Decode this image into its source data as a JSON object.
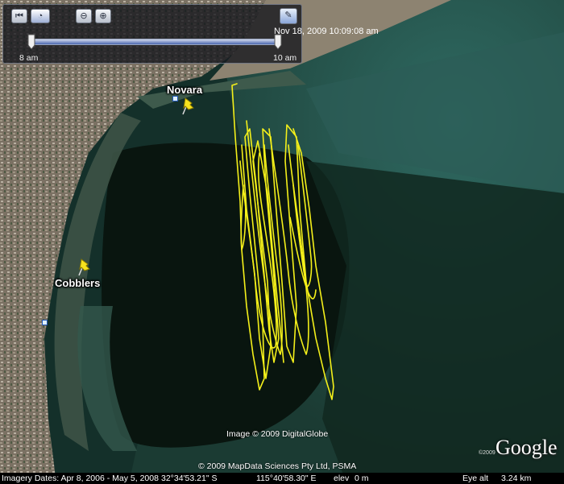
{
  "slider": {
    "date": "Nov 18, 2009  10:09:08 am",
    "start_label": "8 am",
    "end_label": "10 am",
    "back_icon": "skip-back-icon",
    "play_icon": "clock-play-icon",
    "zoom_out_icon": "zoom-out-icon",
    "zoom_in_icon": "zoom-in-icon",
    "settings_icon": "wrench-icon"
  },
  "places": {
    "novara": "Novara",
    "cobblers": "Cobblers"
  },
  "credits": {
    "image": "Image © 2009 DigitalGlobe",
    "data": "© 2009 MapData Sciences Pty Ltd, PSMA",
    "logo_small": "©2009",
    "logo": "Google"
  },
  "status": {
    "imagery_dates": "Imagery Dates: Apr 8, 2006 - May 5, 2008",
    "lat": "32°34'53.21\" S",
    "lon": "115°40'58.30\" E",
    "elev_label": "elev",
    "elev_value": "0 m",
    "eye_label": "Eye alt",
    "eye_value": "3.24 km"
  },
  "colors": {
    "track": "#f4f01a",
    "water_deep": "#0b1a14",
    "water_shallow": "#2f5a4e",
    "land": "#8a7d6c"
  }
}
